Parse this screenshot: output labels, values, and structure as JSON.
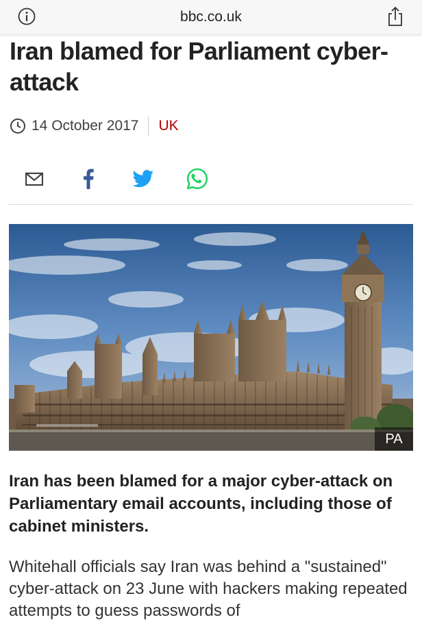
{
  "browser": {
    "url": "bbc.co.uk",
    "info_icon": "info-icon",
    "share_icon": "share-icon"
  },
  "article": {
    "title": "Iran blamed for Parliament cyber-attack",
    "date": "14 October 2017",
    "section": "UK",
    "lead": "Iran has been blamed for a major cyber-attack on Parliamentary email accounts, including those of cabinet ministers.",
    "body": "Whitehall officials say Iran was behind a \"sustained\" cyber-attack on 23 June with hackers making repeated attempts to guess passwords of",
    "image_credit": "PA"
  },
  "share_buttons": [
    {
      "name": "email-share-icon",
      "color": "#404040"
    },
    {
      "name": "facebook-share-icon",
      "color": "#3b5998"
    },
    {
      "name": "twitter-share-icon",
      "color": "#1da1f2"
    },
    {
      "name": "whatsapp-share-icon",
      "color": "#25d366"
    }
  ],
  "colors": {
    "section_red": "#b80000",
    "text": "#222222"
  }
}
